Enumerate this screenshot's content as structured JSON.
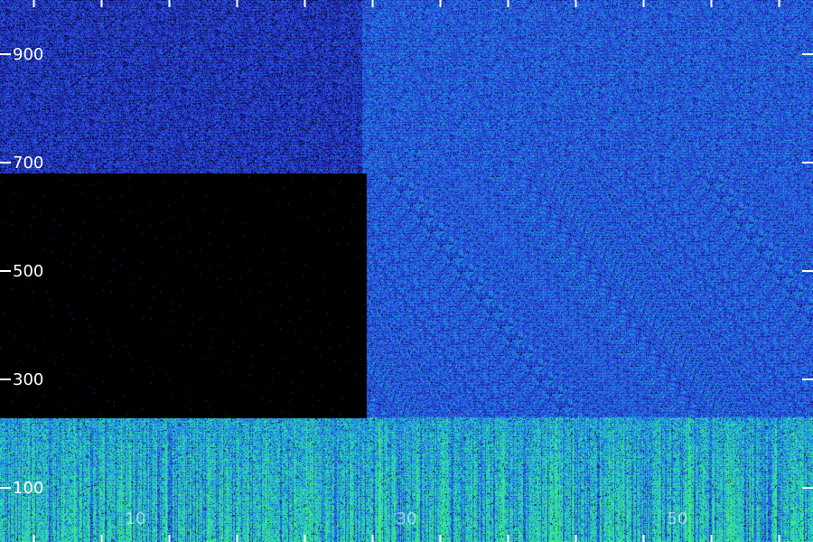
{
  "chart_data": {
    "type": "heatmap",
    "title": "",
    "xlabel": "",
    "ylabel": "",
    "x_ticks": [
      {
        "value": 10,
        "label": "10"
      },
      {
        "value": 30,
        "label": "30"
      },
      {
        "value": 50,
        "label": "50"
      }
    ],
    "y_ticks": [
      {
        "value": 100,
        "label": "100"
      },
      {
        "value": 300,
        "label": "300"
      },
      {
        "value": 500,
        "label": "500"
      },
      {
        "value": 700,
        "label": "700"
      },
      {
        "value": 900,
        "label": "900"
      }
    ],
    "xlim": [
      0,
      60
    ],
    "ylim": [
      0,
      1000
    ],
    "colormap": [
      "#000000",
      "#1a1aa0",
      "#2d44e6",
      "#1e7fe0",
      "#22c8d8",
      "#3cf07a"
    ],
    "regions": [
      {
        "name": "missing-data",
        "x": [
          0,
          27
        ],
        "y": [
          230,
          680
        ],
        "level": 0.0
      },
      {
        "name": "upper-left-band",
        "x": [
          0,
          26.7
        ],
        "y": [
          680,
          1000
        ],
        "level": 0.35
      },
      {
        "name": "upper-right-band",
        "x": [
          26.7,
          60
        ],
        "y": [
          230,
          1000
        ],
        "level": 0.5
      },
      {
        "name": "low-frequency-band",
        "x": [
          0,
          60
        ],
        "y": [
          0,
          230
        ],
        "level": 0.75
      }
    ],
    "grid": false
  }
}
